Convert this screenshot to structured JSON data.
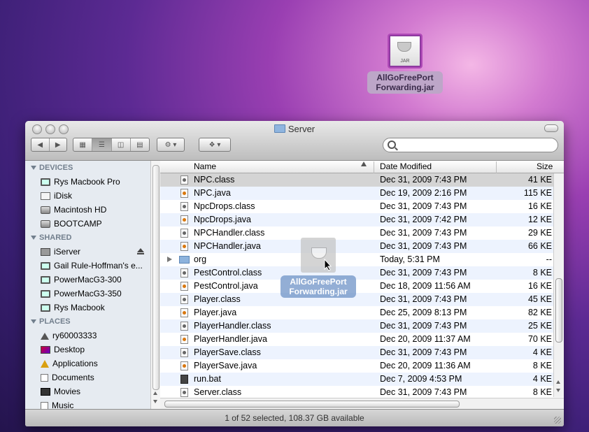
{
  "desktop": {
    "jar_icon": "jar-icon",
    "jar_badge": "JAR",
    "jar_name": "AllGoFreePort Forwarding.jar"
  },
  "window": {
    "title": "Server",
    "search_placeholder": "",
    "status": "1 of 52 selected, 108.37 GB available"
  },
  "sidebar": {
    "devices_header": "DEVICES",
    "devices": [
      "Rys Macbook Pro",
      "iDisk",
      "Macintosh HD",
      "BOOTCAMP"
    ],
    "shared_header": "SHARED",
    "shared": [
      "iServer",
      "Gail Rule-Hoffman's e...",
      "PowerMacG3-300",
      "PowerMacG3-350",
      "Rys Macbook"
    ],
    "places_header": "PLACES",
    "places": [
      "ry60003333",
      "Desktop",
      "Applications",
      "Documents",
      "Movies",
      "Music"
    ]
  },
  "columns": {
    "name": "Name",
    "date": "Date Modified",
    "size": "Size"
  },
  "files": [
    {
      "name": "NPC.class",
      "date": "Dec 31, 2009 7:43 PM",
      "size": "41 KE",
      "type": "cls",
      "selected": true
    },
    {
      "name": "NPC.java",
      "date": "Dec 19, 2009 2:16 PM",
      "size": "115 KE",
      "type": "java"
    },
    {
      "name": "NpcDrops.class",
      "date": "Dec 31, 2009 7:43 PM",
      "size": "16 KE",
      "type": "cls"
    },
    {
      "name": "NpcDrops.java",
      "date": "Dec 31, 2009 7:42 PM",
      "size": "12 KE",
      "type": "java"
    },
    {
      "name": "NPCHandler.class",
      "date": "Dec 31, 2009 7:43 PM",
      "size": "29 KE",
      "type": "cls"
    },
    {
      "name": "NPCHandler.java",
      "date": "Dec 31, 2009 7:43 PM",
      "size": "66 KE",
      "type": "java"
    },
    {
      "name": "org",
      "date": "Today, 5:31 PM",
      "size": "--",
      "type": "folder"
    },
    {
      "name": "PestControl.class",
      "date": "Dec 31, 2009 7:43 PM",
      "size": "8 KE",
      "type": "cls"
    },
    {
      "name": "PestControl.java",
      "date": "Dec 18, 2009 11:56 AM",
      "size": "16 KE",
      "type": "java"
    },
    {
      "name": "Player.class",
      "date": "Dec 31, 2009 7:43 PM",
      "size": "45 KE",
      "type": "cls"
    },
    {
      "name": "Player.java",
      "date": "Dec 25, 2009 8:13 PM",
      "size": "82 KE",
      "type": "java"
    },
    {
      "name": "PlayerHandler.class",
      "date": "Dec 31, 2009 7:43 PM",
      "size": "25 KE",
      "type": "cls"
    },
    {
      "name": "PlayerHandler.java",
      "date": "Dec 20, 2009 11:37 AM",
      "size": "70 KE",
      "type": "java"
    },
    {
      "name": "PlayerSave.class",
      "date": "Dec 31, 2009 7:43 PM",
      "size": "4 KE",
      "type": "cls"
    },
    {
      "name": "PlayerSave.java",
      "date": "Dec 20, 2009 11:36 AM",
      "size": "8 KE",
      "type": "java"
    },
    {
      "name": "run.bat",
      "date": "Dec 7, 2009 4:53 PM",
      "size": "4 KE",
      "type": "bat"
    },
    {
      "name": "Server.class",
      "date": "Dec 31, 2009 7:43 PM",
      "size": "8 KE",
      "type": "cls"
    }
  ],
  "drag_ghost": {
    "label": "AllGoFreePort Forwarding.jar"
  }
}
